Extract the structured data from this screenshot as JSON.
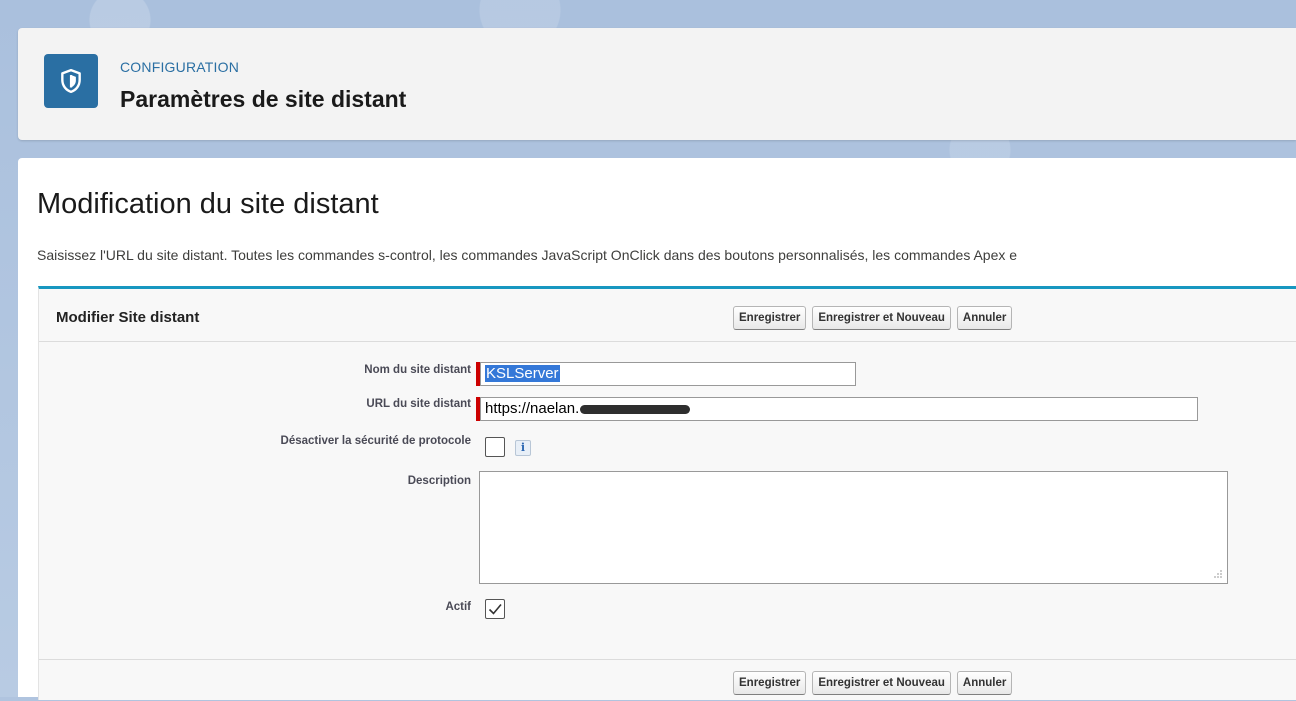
{
  "header": {
    "breadcrumb": "CONFIGURATION",
    "title": "Paramètres de site distant",
    "icon": "shield-icon"
  },
  "main": {
    "section_title": "Modification du site distant",
    "intro": "Saisissez l'URL du site distant. Toutes les commandes s-control, les commandes JavaScript OnClick dans des boutons personnalisés, les commandes Apex e"
  },
  "form": {
    "block_title": "Modifier Site distant",
    "buttons": {
      "save": "Enregistrer",
      "save_new": "Enregistrer et Nouveau",
      "cancel": "Annuler"
    },
    "fields": {
      "name_label": "Nom du site distant",
      "name_value": "KSLServer",
      "url_label": "URL du site distant",
      "url_value": "https://naelan.",
      "protocol_label": "Désactiver la sécurité de protocole",
      "protocol_checked": false,
      "description_label": "Description",
      "description_value": "",
      "active_label": "Actif",
      "active_checked": true
    }
  },
  "colors": {
    "accent": "#1797c0",
    "icon_bg": "#2a6fa3",
    "required": "#cc0000"
  }
}
